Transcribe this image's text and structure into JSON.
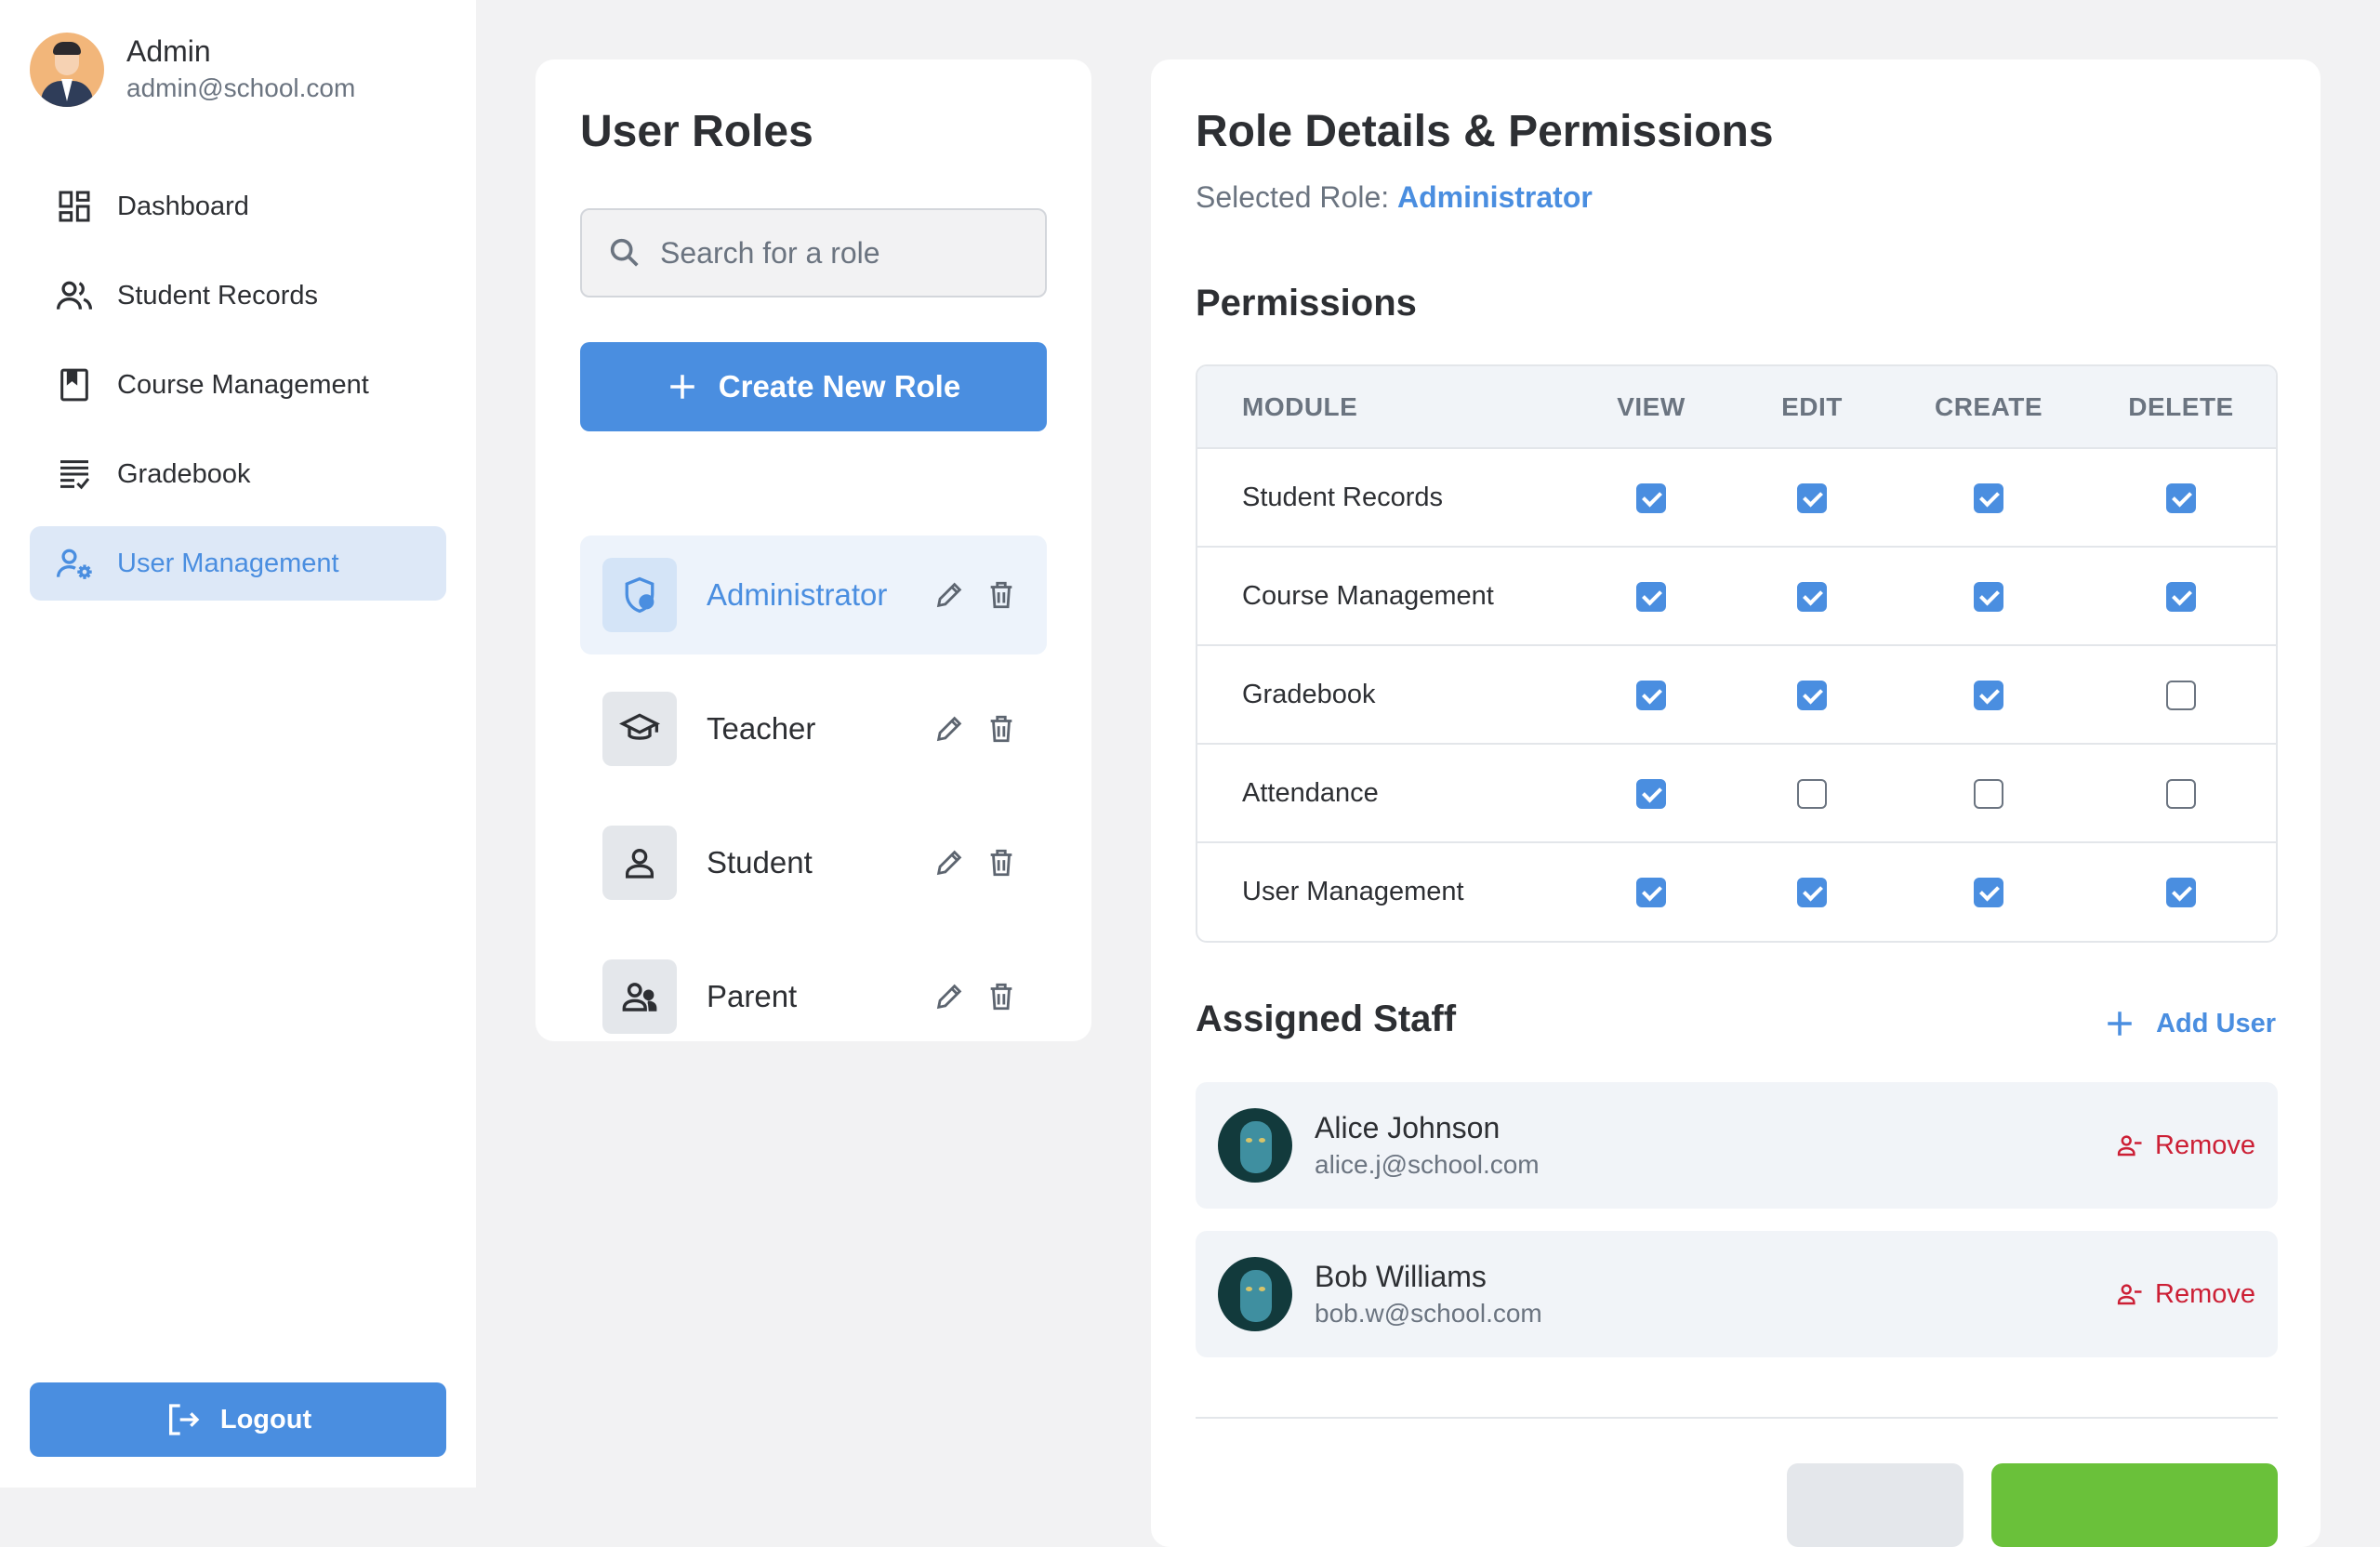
{
  "profile": {
    "name": "Admin",
    "email": "admin@school.com"
  },
  "nav": {
    "items": [
      {
        "label": "Dashboard",
        "icon": "dashboard-icon"
      },
      {
        "label": "Student Records",
        "icon": "people-icon"
      },
      {
        "label": "Course Management",
        "icon": "book-icon"
      },
      {
        "label": "Gradebook",
        "icon": "checklist-icon"
      },
      {
        "label": "User Management",
        "icon": "user-gear-icon",
        "active": true
      }
    ],
    "logout_label": "Logout"
  },
  "roles": {
    "title": "User Roles",
    "search_placeholder": "Search for a role",
    "create_label": "Create New Role",
    "items": [
      {
        "label": "Administrator",
        "icon": "shield-user-icon",
        "active": true
      },
      {
        "label": "Teacher",
        "icon": "graduation-cap-icon"
      },
      {
        "label": "Student",
        "icon": "person-icon"
      },
      {
        "label": "Parent",
        "icon": "parent-icon"
      }
    ]
  },
  "details": {
    "title": "Role Details & Permissions",
    "selected_prefix": "Selected Role:",
    "selected_role": "Administrator",
    "permissions_title": "Permissions",
    "columns": [
      "MODULE",
      "VIEW",
      "EDIT",
      "CREATE",
      "DELETE"
    ],
    "rows": [
      {
        "module": "Student Records",
        "perms": [
          true,
          true,
          true,
          true
        ]
      },
      {
        "module": "Course Management",
        "perms": [
          true,
          true,
          true,
          true
        ]
      },
      {
        "module": "Gradebook",
        "perms": [
          true,
          true,
          true,
          false
        ]
      },
      {
        "module": "Attendance",
        "perms": [
          true,
          false,
          false,
          false
        ]
      },
      {
        "module": "User Management",
        "perms": [
          true,
          true,
          true,
          true
        ]
      }
    ],
    "staff_title": "Assigned Staff",
    "add_user_label": "Add User",
    "remove_label": "Remove",
    "staff": [
      {
        "name": "Alice Johnson",
        "email": "alice.j@school.com"
      },
      {
        "name": "Bob Williams",
        "email": "bob.w@school.com"
      }
    ]
  },
  "colors": {
    "accent": "#4a8ee0",
    "danger": "#cc1f35",
    "success": "#6ac13a"
  }
}
